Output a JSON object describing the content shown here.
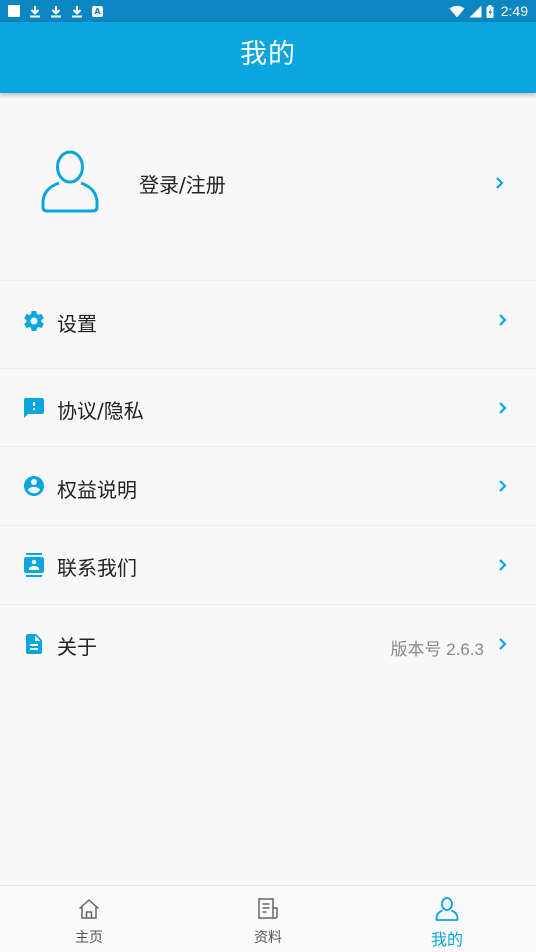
{
  "status_bar": {
    "time": "2:49"
  },
  "header": {
    "title": "我的"
  },
  "profile": {
    "login_label": "登录/注册"
  },
  "menu": [
    {
      "label": "设置",
      "icon": "gear-icon",
      "value": ""
    },
    {
      "label": "协议/隐私",
      "icon": "feedback-icon",
      "value": ""
    },
    {
      "label": "权益说明",
      "icon": "account-circle-icon",
      "value": ""
    },
    {
      "label": "联系我们",
      "icon": "contacts-icon",
      "value": ""
    },
    {
      "label": "关于",
      "icon": "document-icon",
      "value": "版本号 2.6.3"
    }
  ],
  "tabs": [
    {
      "label": "主页",
      "icon": "home-icon",
      "active": false
    },
    {
      "label": "资料",
      "icon": "news-icon",
      "active": false
    },
    {
      "label": "我的",
      "icon": "person-icon",
      "active": true
    }
  ],
  "colors": {
    "primary": "#0ba6df",
    "status_bar": "#0a86c0",
    "background": "#f8f8f8",
    "accent_text": "#0ba6df"
  }
}
